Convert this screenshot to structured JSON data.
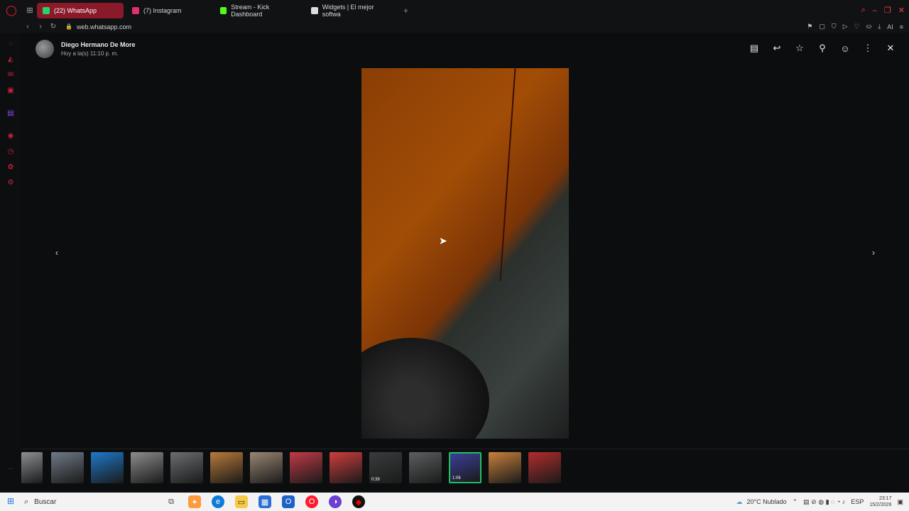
{
  "browser": {
    "tabs": [
      {
        "label": "(22) WhatsApp",
        "active": true,
        "favicon_color": "#25d366",
        "badge": "22"
      },
      {
        "label": "(7) Instagram",
        "active": false,
        "favicon_color": "#e1306c"
      },
      {
        "label": "Stream - Kick Dashboard",
        "active": false,
        "favicon_color": "#53fc18"
      },
      {
        "label": "Widgets | El mejor softwa",
        "active": false,
        "favicon_color": "#dddddd"
      }
    ],
    "new_tab": "+",
    "url": "web.whatsapp.com"
  },
  "viewer": {
    "sender_name": "Diego Hermano De More",
    "sender_time": "Hoy a la(s) 11:10 p. m.",
    "actions": [
      {
        "name": "chat-icon",
        "glyph": "▤"
      },
      {
        "name": "reply-icon",
        "glyph": "↩"
      },
      {
        "name": "star-icon",
        "glyph": "☆"
      },
      {
        "name": "pin-icon",
        "glyph": "⚲"
      },
      {
        "name": "emoji-icon",
        "glyph": "☺"
      },
      {
        "name": "menu-icon",
        "glyph": "⋮"
      },
      {
        "name": "close-icon",
        "glyph": "✕"
      }
    ],
    "prev_arrow": "‹",
    "next_arrow": "›",
    "thumbnails": [
      {
        "color": "#8c9094",
        "duration": ""
      },
      {
        "color": "#6f7a85",
        "duration": ""
      },
      {
        "color": "#1e79c9",
        "duration": ""
      },
      {
        "color": "#8d8d8d",
        "duration": ""
      },
      {
        "color": "#6b6e70",
        "duration": ""
      },
      {
        "color": "#b97a3a",
        "duration": ""
      },
      {
        "color": "#9a8773",
        "duration": ""
      },
      {
        "color": "#c23a46",
        "duration": ""
      },
      {
        "color": "#cf3d3d",
        "duration": ""
      },
      {
        "color": "#3a3c3d",
        "duration": "0:39"
      },
      {
        "color": "#5c5f60",
        "duration": ""
      },
      {
        "color": "#3b3f98",
        "duration": "1:06",
        "selected": true
      },
      {
        "color": "#c9813b",
        "duration": ""
      },
      {
        "color": "#b22c2c",
        "duration": ""
      }
    ]
  },
  "taskbar": {
    "search_placeholder": "Buscar",
    "weather": "20°C  Nublado",
    "lang": "ESP",
    "time": "23:17",
    "date": "15/2/2026"
  }
}
